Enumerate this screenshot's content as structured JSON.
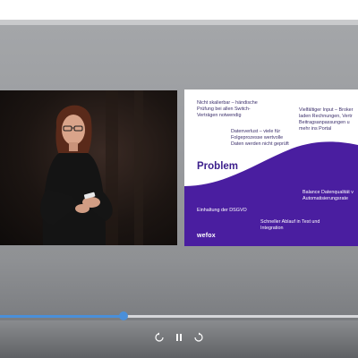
{
  "player": {
    "progress_fraction": 0.345,
    "controls": {
      "rewind_icon": "rewind-10-icon",
      "pause_icon": "pause-icon",
      "forward_icon": "forward-10-icon"
    }
  },
  "slide": {
    "title": "Problem",
    "logo": "wefox",
    "texts": {
      "top_left": "Nicht skalierbar – händische\nPrüfung bei allen Switch-\nVerträgen notwendig",
      "top_right": "Vielfältiger Input – Broker\nladen Rechnungen, Vertr\nBeitragsanpassungen u\nmehr ins Portal",
      "middle": "Datenverlust – viele für\nFolgeprozesse wertvolle\nDaten werden nicht geprüft",
      "bottom_right": "Balance Datenqualität v\nAutomatisierungsrate",
      "bottom_left": "Einhaltung der DSGVO",
      "bottom_center": "Schneller Ablauf in Test und\nIntegration"
    },
    "colors": {
      "purple": "#4a1ea0",
      "title": "#3c1f8c"
    }
  }
}
